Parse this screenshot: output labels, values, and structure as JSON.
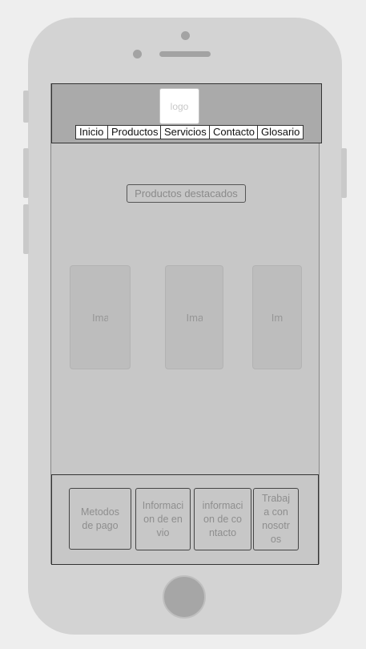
{
  "header": {
    "logo_text": "logo"
  },
  "nav": {
    "items": [
      {
        "label": "Inicio"
      },
      {
        "label": "Productos"
      },
      {
        "label": "Servicios"
      },
      {
        "label": "Contacto"
      },
      {
        "label": "Glosario"
      }
    ]
  },
  "main": {
    "featured_title": "Productos destacados",
    "image_cards": [
      {
        "label": "Ima"
      },
      {
        "label": "Ima"
      },
      {
        "label": "Im"
      }
    ]
  },
  "footer": {
    "boxes": [
      {
        "label": "Metodos de pago"
      },
      {
        "label": "Informacion de envio"
      },
      {
        "label": "informacion de contacto"
      },
      {
        "label": "Trabaja con nosotros"
      }
    ]
  }
}
